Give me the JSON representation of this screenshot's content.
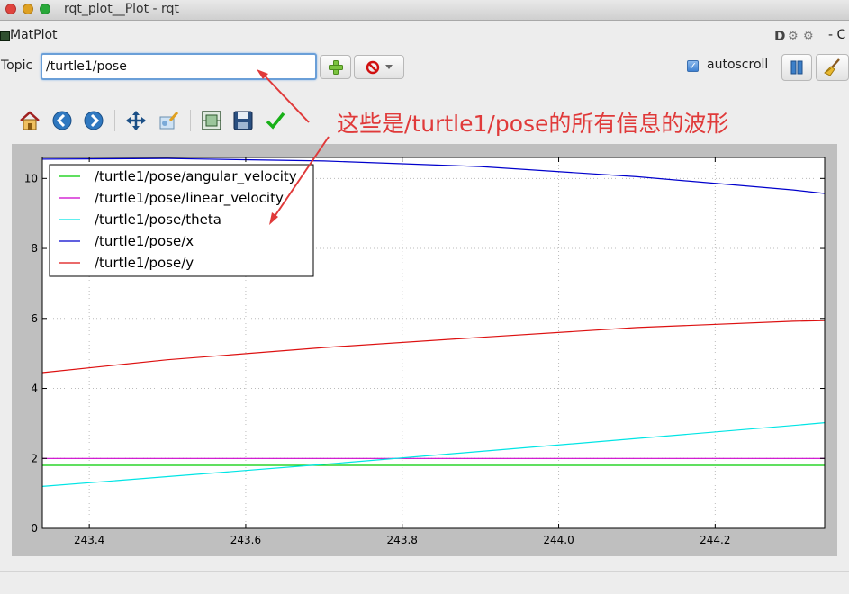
{
  "window": {
    "title": "rqt_plot__Plot - rqt"
  },
  "plugin": {
    "name": "MatPlot",
    "d_label": "D",
    "close_label": "- C"
  },
  "topic_row": {
    "label": "Topic",
    "value": "/turtle1/pose",
    "autoscroll_label": "autoscroll",
    "autoscroll_checked": true
  },
  "toolbar": {
    "icons": [
      "home-icon",
      "back-icon",
      "forward-icon",
      "pan-icon",
      "zoom-icon",
      "subplots-icon",
      "save-icon",
      "edit-icon"
    ]
  },
  "annotation": {
    "prefix": "这些是",
    "topic": "/turtle1/pose",
    "suffix": "的所有信息的波形",
    "color": "#e03a3a"
  },
  "chart_data": {
    "type": "line",
    "xlim": [
      243.34,
      244.34
    ],
    "ylim": [
      0,
      10.6
    ],
    "xticks": [
      "243.4",
      "243.6",
      "243.8",
      "244.0",
      "244.2"
    ],
    "xtick_values": [
      243.4,
      243.6,
      243.8,
      244.0,
      244.2
    ],
    "yticks": [
      "0",
      "2",
      "4",
      "6",
      "8",
      "10"
    ],
    "ytick_values": [
      0,
      2,
      4,
      6,
      8,
      10
    ],
    "grid": true,
    "legend_position": "top-left",
    "series": [
      {
        "name": "/turtle1/pose/angular_velocity",
        "color": "#00cc00",
        "x": [
          243.34,
          243.6,
          243.8,
          244.0,
          244.2,
          244.34
        ],
        "values": [
          1.8,
          1.8,
          1.8,
          1.8,
          1.8,
          1.8
        ]
      },
      {
        "name": "/turtle1/pose/linear_velocity",
        "color": "#cc00cc",
        "x": [
          243.34,
          243.6,
          243.8,
          244.0,
          244.2,
          244.34
        ],
        "values": [
          2.0,
          2.0,
          2.0,
          2.0,
          2.0,
          2.0
        ]
      },
      {
        "name": "/turtle1/pose/theta",
        "color": "#00e5e5",
        "x": [
          243.34,
          243.5,
          243.7,
          243.9,
          244.1,
          244.3,
          244.34
        ],
        "values": [
          1.2,
          1.48,
          1.83,
          2.2,
          2.57,
          2.94,
          3.02
        ]
      },
      {
        "name": "/turtle1/pose/x",
        "color": "#0000cc",
        "x": [
          243.34,
          243.5,
          243.7,
          243.9,
          244.1,
          244.3,
          244.34
        ],
        "values": [
          10.55,
          10.57,
          10.5,
          10.34,
          10.05,
          9.67,
          9.57
        ]
      },
      {
        "name": "/turtle1/pose/y",
        "color": "#dd1111",
        "x": [
          243.34,
          243.5,
          243.7,
          243.9,
          244.1,
          244.3,
          244.34
        ],
        "values": [
          4.45,
          4.82,
          5.17,
          5.46,
          5.74,
          5.92,
          5.94
        ]
      }
    ]
  }
}
